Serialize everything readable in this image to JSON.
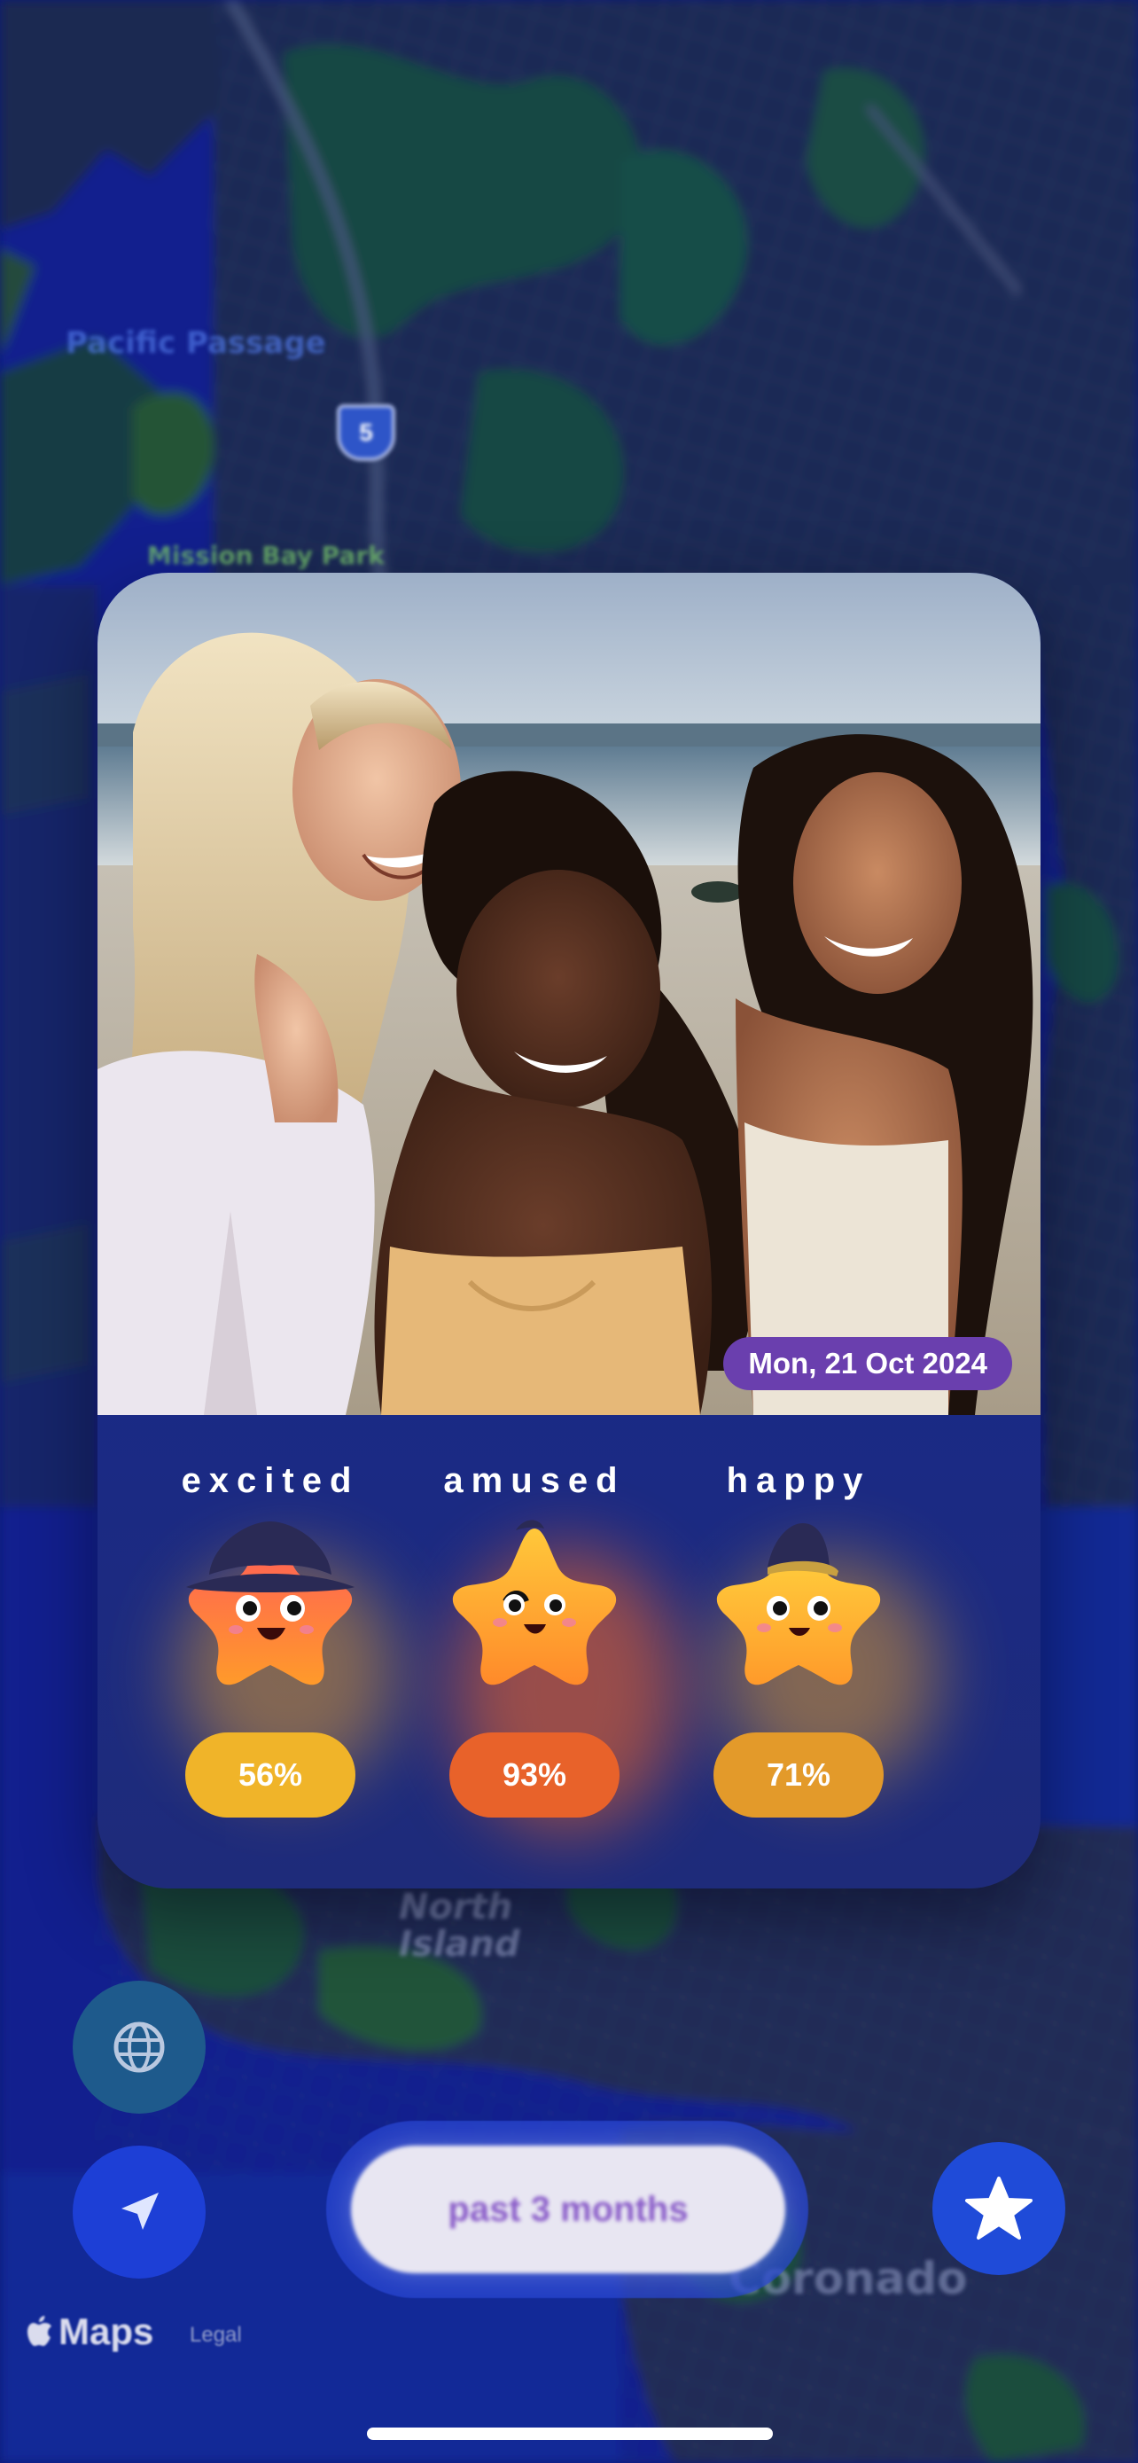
{
  "map": {
    "labels": [
      "Pacific Passage",
      "Mission Bay Park",
      "North Island",
      "Coronado"
    ],
    "interstate_shield": "5"
  },
  "memory_card": {
    "date": "Mon, 21 Oct 2024",
    "moods": [
      {
        "label": "excited",
        "percent": "56%",
        "pill_color": "#f0b429"
      },
      {
        "label": "amused",
        "percent": "93%",
        "pill_color": "#e8622a"
      },
      {
        "label": "happy",
        "percent": "71%",
        "pill_color": "#e39a2a"
      }
    ]
  },
  "controls": {
    "globe_icon": "globe-icon",
    "locate_icon": "location-arrow-icon",
    "favorite_icon": "star-icon",
    "time_range_label": "past 3 months"
  },
  "attribution": {
    "maps_label": "Maps",
    "legal_label": "Legal"
  }
}
